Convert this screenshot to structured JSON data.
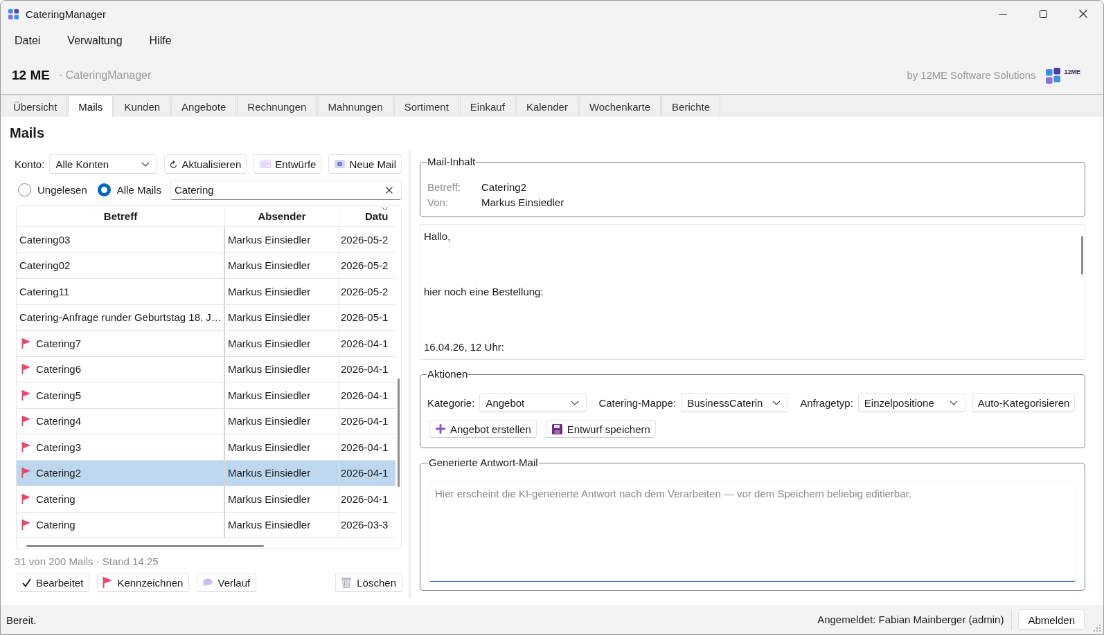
{
  "window": {
    "title": "CateringManager"
  },
  "menu": [
    "Datei",
    "Verwaltung",
    "Hilfe"
  ],
  "header": {
    "brand": "12 ME",
    "subtitle": "· CateringManager",
    "vendor": "by 12ME Software Solutions",
    "logo_text": "12ME"
  },
  "tabs": [
    {
      "label": "Übersicht",
      "selected": false
    },
    {
      "label": "Mails",
      "selected": true
    },
    {
      "label": "Kunden",
      "selected": false
    },
    {
      "label": "Angebote",
      "selected": false
    },
    {
      "label": "Rechnungen",
      "selected": false
    },
    {
      "label": "Mahnungen",
      "selected": false
    },
    {
      "label": "Sortiment",
      "selected": false
    },
    {
      "label": "Einkauf",
      "selected": false
    },
    {
      "label": "Kalender",
      "selected": false
    },
    {
      "label": "Wochenkarte",
      "selected": false
    },
    {
      "label": "Berichte",
      "selected": false
    }
  ],
  "page_title": "Mails",
  "mail_list": {
    "account_label": "Konto:",
    "account": "Alle Konten",
    "toolbar": [
      {
        "label": "Aktualisieren",
        "kind": "refresh"
      },
      {
        "label": "Entwürfe",
        "kind": "drafts"
      },
      {
        "label": "Neue Mail",
        "kind": "new"
      }
    ],
    "filters": [
      {
        "label": "Ungelesen",
        "selected": false
      },
      {
        "label": "Alle Mails",
        "selected": true
      }
    ],
    "search": {
      "value": "Catering"
    },
    "columns": [
      "Betreff",
      "Absender",
      "Datu"
    ],
    "rows": [
      {
        "subject": "Catering03",
        "sender": "Markus Einsiedler",
        "date": "2026-05-2",
        "flagged": false,
        "selected": false
      },
      {
        "subject": "Catering02",
        "sender": "Markus Einsiedler",
        "date": "2026-05-2",
        "flagged": false,
        "selected": false
      },
      {
        "subject": "Catering11",
        "sender": "Markus Einsiedler",
        "date": "2026-05-2",
        "flagged": false,
        "selected": false
      },
      {
        "subject": "Catering-Anfrage runder Geburtstag 18. J…",
        "sender": "Markus Einsiedler",
        "date": "2026-05-1",
        "flagged": false,
        "selected": false
      },
      {
        "subject": "Catering7",
        "sender": "Markus Einsiedler",
        "date": "2026-04-1",
        "flagged": true,
        "selected": false
      },
      {
        "subject": "Catering6",
        "sender": "Markus Einsiedler",
        "date": "2026-04-1",
        "flagged": true,
        "selected": false
      },
      {
        "subject": "Catering5",
        "sender": "Markus Einsiedler",
        "date": "2026-04-1",
        "flagged": true,
        "selected": false
      },
      {
        "subject": "Catering4",
        "sender": "Markus Einsiedler",
        "date": "2026-04-1",
        "flagged": true,
        "selected": false
      },
      {
        "subject": "Catering3",
        "sender": "Markus Einsiedler",
        "date": "2026-04-1",
        "flagged": true,
        "selected": false
      },
      {
        "subject": "Catering2",
        "sender": "Markus Einsiedler",
        "date": "2026-04-1",
        "flagged": true,
        "selected": true
      },
      {
        "subject": "Catering",
        "sender": "Markus Einsiedler",
        "date": "2026-04-1",
        "flagged": true,
        "selected": false
      },
      {
        "subject": "Catering",
        "sender": "Markus Einsiedler",
        "date": "2026-03-3",
        "flagged": true,
        "selected": false
      }
    ],
    "summary": "31 von 200 Mails · Stand 14:25",
    "actions": [
      {
        "label": "Bearbeitet",
        "kind": "done"
      },
      {
        "label": "Kennzeichnen",
        "kind": "flag"
      },
      {
        "label": "Verlauf",
        "kind": "history"
      },
      {
        "label": "Löschen",
        "kind": "delete"
      }
    ]
  },
  "mail_content": {
    "title": "Mail-Inhalt",
    "fields": [
      {
        "label": "Betreff:",
        "value": "Catering2"
      },
      {
        "label": "Von:",
        "value": "Markus Einsiedler"
      }
    ],
    "body": "Hallo,\n\n\nhier noch eine Bestellung:\n\n\n16.04.26, 12 Uhr:"
  },
  "actions": {
    "title": "Aktionen",
    "selects": [
      {
        "label": "Kategorie:",
        "value": "Angebot"
      },
      {
        "label": "Catering-Mappe:",
        "value": "BusinessCaterin"
      },
      {
        "label": "Anfragetyp:",
        "value": "Einzelpositione"
      }
    ],
    "auto_button": "Auto-Kategorisieren",
    "buttons": [
      {
        "label": "Angebot erstellen",
        "kind": "create"
      },
      {
        "label": "Entwurf speichern",
        "kind": "save"
      }
    ]
  },
  "reply": {
    "title": "Generierte Antwort-Mail",
    "placeholder": "Hier erscheint die KI-generierte Antwort nach dem Verarbeiten — vor dem Speichern beliebig editierbar."
  },
  "status_bar": {
    "message": "Bereit.",
    "user": "Angemeldet: Fabian Mainberger (admin)",
    "logout": "Abmelden"
  }
}
